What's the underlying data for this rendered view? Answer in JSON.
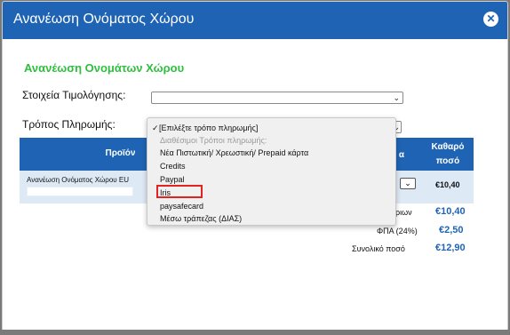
{
  "modal": {
    "title": "Ανανέωση Ονόματος Χώρου",
    "close_icon": "close-icon"
  },
  "section": {
    "heading": "Ανανέωση Ονομάτων Χώρου"
  },
  "form": {
    "billing_label": "Στοιχεία Τιμολόγησης:",
    "billing_value": "",
    "payment_label": "Τρόπος Πληρωμής:"
  },
  "table": {
    "col_product": "Προϊόν",
    "col_partial": "α",
    "col_net_line1": "Καθαρό",
    "col_net_line2": "ποσό",
    "row": {
      "product": "Ανανέωση Ονόματος Χώρου EU",
      "price": "€10,40"
    }
  },
  "summary": {
    "subtotal_label": "όριων",
    "subtotal_value": "€10,40",
    "vat_label": "ΦΠΑ (24%)",
    "vat_value": "€2,50",
    "total_label": "Συνολικό ποσό",
    "total_value": "€12,90"
  },
  "dropdown": {
    "selected": "[Επιλέξτε τρόπο πληρωμής]",
    "group_label": "Διαθέσιμοι Τρόποι πληρωμής:",
    "options": [
      "Νέα Πιστωτική/ Χρεωστική/ Prepaid κάρτα",
      "Credits",
      "Paypal",
      "Iris",
      "paysafecard",
      "Μέσω τράπεζας (ΔΙΑΣ)"
    ],
    "highlighted_option": "Iris"
  },
  "colors": {
    "header_blue": "#1f64b4",
    "heading_green": "#2fbf3f",
    "highlight_red": "#e3231f"
  }
}
